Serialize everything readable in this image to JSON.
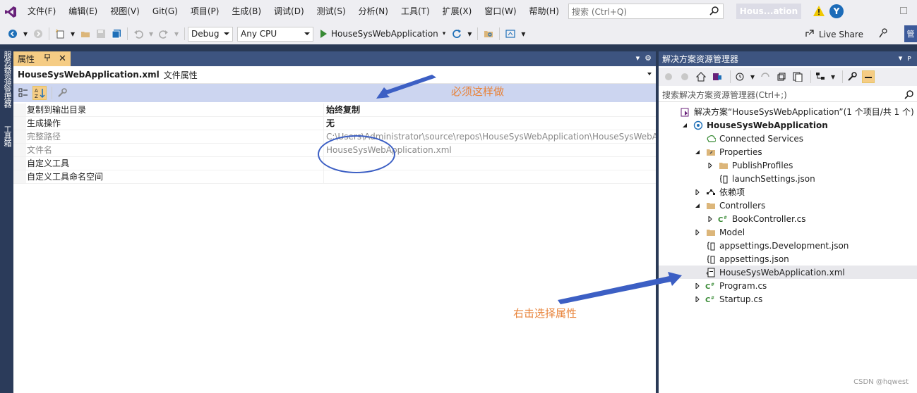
{
  "menubar": {
    "items": [
      "文件(F)",
      "编辑(E)",
      "视图(V)",
      "Git(G)",
      "项目(P)",
      "生成(B)",
      "调试(D)",
      "测试(S)",
      "分析(N)",
      "工具(T)",
      "扩展(X)",
      "窗口(W)",
      "帮助(H)"
    ],
    "search_placeholder": "搜索 (Ctrl+Q)",
    "title_badge": "Hous...ation",
    "avatar_letter": "Y"
  },
  "toolbar": {
    "config": "Debug",
    "platform": "Any CPU",
    "run_target": "HouseSysWebApplication",
    "live_share": "Live Share",
    "admin_badge": "管"
  },
  "sidebar": {
    "tab1": "服务器资源管理器",
    "tab2": "工具箱"
  },
  "properties": {
    "tab_label": "属性",
    "pin": "ᴘ",
    "close": "✕",
    "object_name": "HouseSysWebApplication.xml",
    "object_type": "文件属性",
    "rows": [
      {
        "name": "复制到输出目录",
        "value": "始终复制",
        "bold": true,
        "grey": false
      },
      {
        "name": "生成操作",
        "value": "无",
        "bold": true,
        "grey": false
      },
      {
        "name": "完整路径",
        "value": "C:\\Users\\Administrator\\source\\repos\\HouseSysWebApplication\\HouseSysWebA",
        "bold": false,
        "grey": true
      },
      {
        "name": "文件名",
        "value": "HouseSysWebApplication.xml",
        "bold": false,
        "grey": true
      },
      {
        "name": "自定义工具",
        "value": "",
        "bold": false,
        "grey": false
      },
      {
        "name": "自定义工具命名空间",
        "value": "",
        "bold": false,
        "grey": false
      }
    ]
  },
  "annotations": {
    "must_do": "必须这样做",
    "right_click": "右击选择属性"
  },
  "solution_explorer": {
    "title": "解决方案资源管理器",
    "search_placeholder": "搜索解决方案资源管理器(Ctrl+;)",
    "items": [
      {
        "label": "解决方案“HouseSysWebApplication”(1 个项目/共 1 个)",
        "indent": 0,
        "exp": "",
        "icon": "solution-icon",
        "bold": false,
        "sel": false
      },
      {
        "label": "HouseSysWebApplication",
        "indent": 1,
        "exp": "open",
        "icon": "web-project-icon",
        "bold": true,
        "sel": false
      },
      {
        "label": "Connected Services",
        "indent": 2,
        "exp": "",
        "icon": "connected-services-icon",
        "bold": false,
        "sel": false
      },
      {
        "label": "Properties",
        "indent": 2,
        "exp": "open",
        "icon": "properties-folder-icon",
        "bold": false,
        "sel": false
      },
      {
        "label": "PublishProfiles",
        "indent": 3,
        "exp": "closed",
        "icon": "folder-icon",
        "bold": false,
        "sel": false
      },
      {
        "label": "launchSettings.json",
        "indent": 3,
        "exp": "",
        "icon": "json-file-icon",
        "bold": false,
        "sel": false
      },
      {
        "label": "依赖项",
        "indent": 2,
        "exp": "closed",
        "icon": "dependencies-icon",
        "bold": false,
        "sel": false
      },
      {
        "label": "Controllers",
        "indent": 2,
        "exp": "open",
        "icon": "folder-icon",
        "bold": false,
        "sel": false
      },
      {
        "label": "BookController.cs",
        "indent": 3,
        "exp": "closed",
        "icon": "csharp-file-icon",
        "bold": false,
        "sel": false
      },
      {
        "label": "Model",
        "indent": 2,
        "exp": "closed",
        "icon": "folder-icon",
        "bold": false,
        "sel": false
      },
      {
        "label": "appsettings.Development.json",
        "indent": 2,
        "exp": "",
        "icon": "json-file-icon",
        "bold": false,
        "sel": false
      },
      {
        "label": "appsettings.json",
        "indent": 2,
        "exp": "",
        "icon": "json-file-icon",
        "bold": false,
        "sel": false
      },
      {
        "label": "HouseSysWebApplication.xml",
        "indent": 2,
        "exp": "",
        "icon": "xml-file-icon",
        "bold": false,
        "sel": true
      },
      {
        "label": "Program.cs",
        "indent": 2,
        "exp": "closed",
        "icon": "csharp-file-icon",
        "bold": false,
        "sel": false
      },
      {
        "label": "Startup.cs",
        "indent": 2,
        "exp": "closed",
        "icon": "csharp-file-icon",
        "bold": false,
        "sel": false
      }
    ]
  },
  "watermark": "CSDN @hqwest",
  "colors": {
    "accent_blue": "#3c5fc4",
    "annotation_orange": "#e8833a",
    "panel_header": "#3d5480",
    "active_tab": "#f5cc84"
  }
}
